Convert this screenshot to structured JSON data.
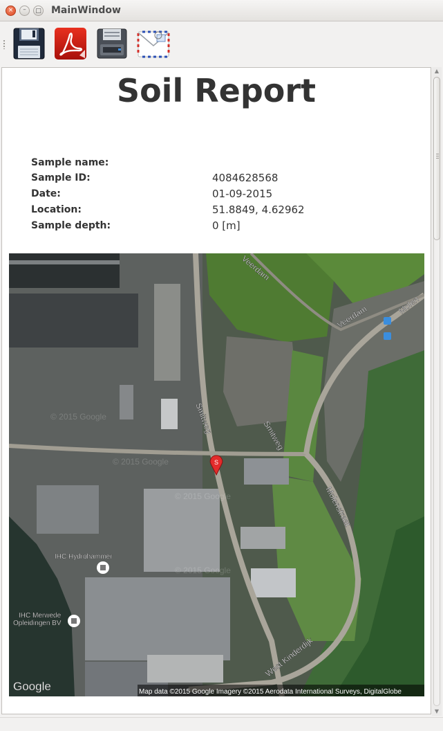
{
  "window": {
    "title": "MainWindow",
    "close_glyph": "×",
    "minimize_glyph": "–",
    "maximize_glyph": "□"
  },
  "toolbar": {
    "items": [
      {
        "name": "save",
        "icon": "floppy-disk-icon"
      },
      {
        "name": "export-pdf",
        "icon": "pdf-icon"
      },
      {
        "name": "print",
        "icon": "printer-icon"
      },
      {
        "name": "email",
        "icon": "envelope-icon"
      }
    ]
  },
  "report": {
    "title": "Soil Report",
    "fields": [
      {
        "label": "Sample name:",
        "value": ""
      },
      {
        "label": "Sample ID:",
        "value": "4084628568"
      },
      {
        "label": "Date:",
        "value": "01-09-2015"
      },
      {
        "label": "Location:",
        "value": "51.8849, 4.62962"
      },
      {
        "label": "Sample depth:",
        "value": "0 [m]"
      }
    ]
  },
  "map": {
    "marker_label": "S",
    "streets": [
      "Veerdam",
      "Veerdam",
      "Molen",
      "Smitweg",
      "Smitweg",
      "Molenstraat",
      "West Kinderdijk"
    ],
    "places": [
      "IHC Hydrohammer",
      "IHC Merwede\nOpleidingen BV"
    ],
    "logo": "Google",
    "attribution": "Map data ©2015 Google  Imagery ©2015 Aerodata International Surveys, DigitalGlobe",
    "watermarks": [
      "© 2015 Google",
      "© 2015 Google",
      "© 2015 Google",
      "© 2015 Google"
    ]
  },
  "scrollbar": {
    "up_glyph": "▲",
    "down_glyph": "▼",
    "position": 0.0
  },
  "colors": {
    "accent_close": "#dd4a24",
    "marker": "#e32b2b",
    "title_text": "#333333"
  }
}
